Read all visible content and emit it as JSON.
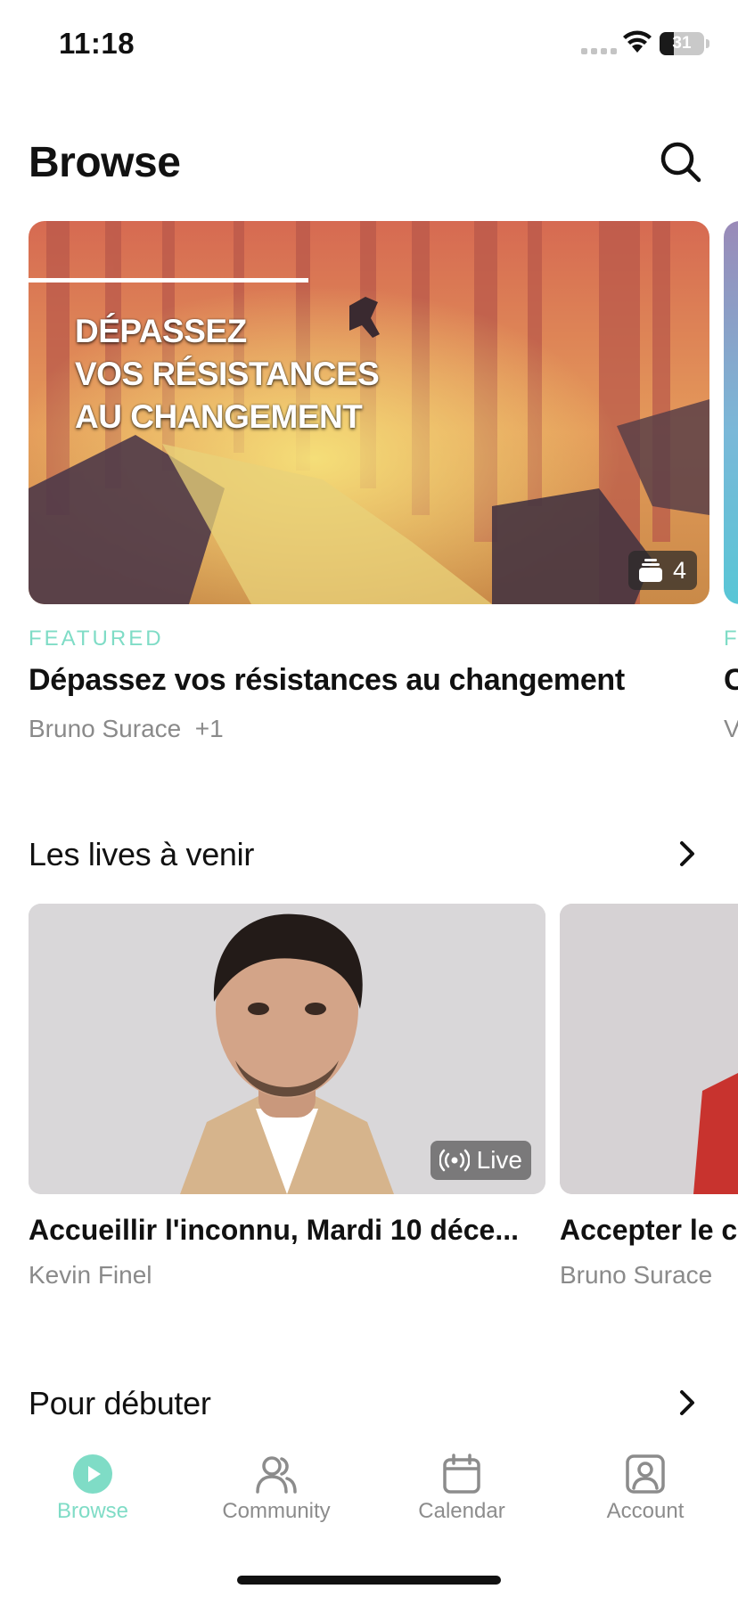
{
  "status_bar": {
    "time": "11:18",
    "battery": "31",
    "battery_fraction": 0.31
  },
  "header": {
    "title": "Browse",
    "search_icon": "search-icon"
  },
  "featured": {
    "label": "FEATURED",
    "image_text": "DÉPASSEZ\nVOS RÉSISTANCES\nAU CHANGEMENT",
    "count": "4",
    "count_icon": "stack-icon",
    "title": "Dépassez vos résistances au changement",
    "author": "Bruno Surace",
    "extra_authors": "+1",
    "peek": {
      "label": "F",
      "title": "C",
      "subtitle": "V"
    }
  },
  "lives_section": {
    "title": "Les lives à venir",
    "items": [
      {
        "title": "Accueillir l'inconnu, Mardi 10 déce...",
        "author": "Kevin Finel",
        "badge": "Live"
      },
      {
        "title": "Accepter le cl",
        "author": "Bruno Surace"
      }
    ]
  },
  "beginner_section": {
    "title": "Pour débuter"
  },
  "tab_bar": {
    "items": [
      {
        "label": "Browse",
        "icon": "play-circle-icon",
        "active": true
      },
      {
        "label": "Community",
        "icon": "users-icon",
        "active": false
      },
      {
        "label": "Calendar",
        "icon": "calendar-icon",
        "active": false
      },
      {
        "label": "Account",
        "icon": "account-icon",
        "active": false
      }
    ]
  },
  "colors": {
    "accent": "#7fdcc6",
    "text": "#111111",
    "secondary": "#8a8a8a"
  }
}
